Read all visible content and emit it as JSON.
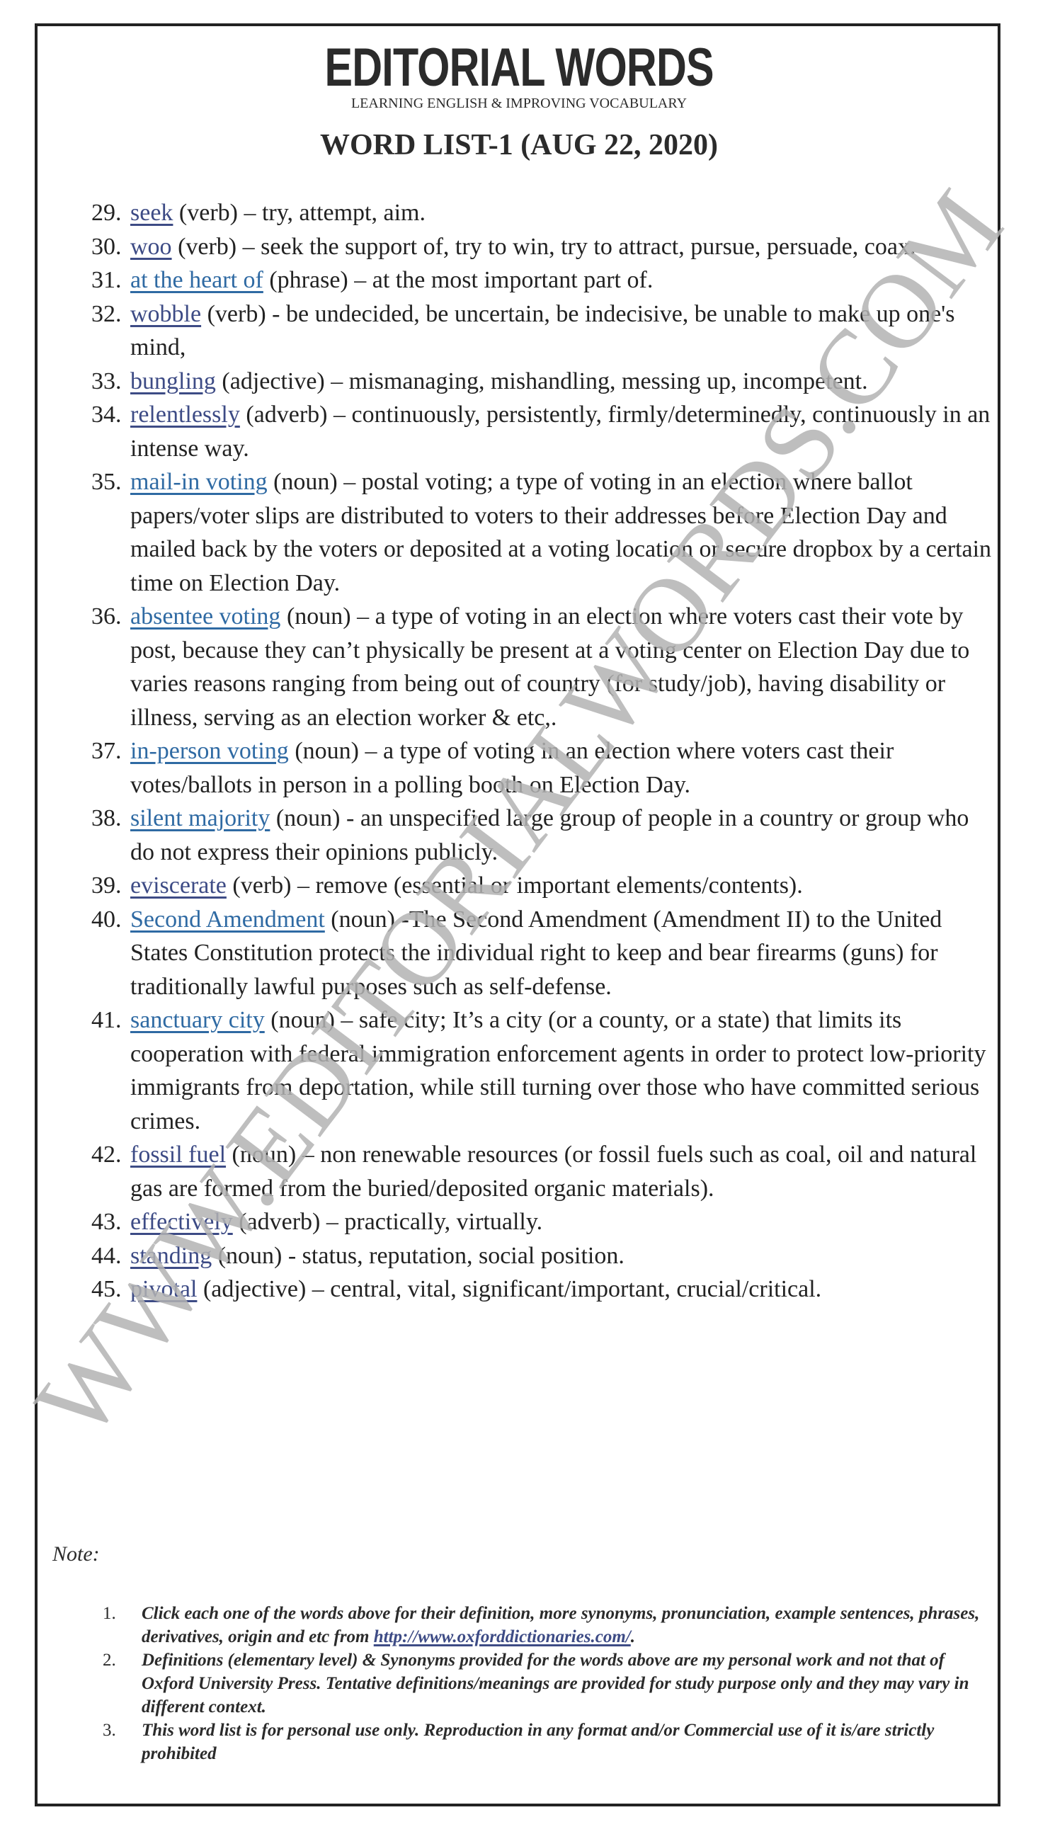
{
  "header": {
    "brand": "EDITORIAL WORDS",
    "tagline": "LEARNING ENGLISH & IMPROVING VOCABULARY",
    "list_title": "WORD LIST-1 (AUG 22, 2020)"
  },
  "watermark": "WWW.EDITORIALWORDS.COM",
  "colors": {
    "link_navy": "#3d4b85",
    "link_steel": "#2f6aa3",
    "text": "#222222",
    "watermark": "#b3b3b3"
  },
  "words": [
    {
      "num": "29.",
      "word": "seek",
      "color": "navy",
      "rest": " (verb) – try, attempt, aim."
    },
    {
      "num": "30.",
      "word": "woo",
      "color": "navy",
      "rest": " (verb) – seek the support of, try to win, try to attract, pursue, persuade, coax."
    },
    {
      "num": "31.",
      "word": "at the heart of",
      "color": "steel",
      "rest": " (phrase) – at the most important part of."
    },
    {
      "num": "32.",
      "word": "wobble",
      "color": "navy",
      "rest": " (verb) - be undecided, be uncertain, be indecisive, be unable to make up one's mind,"
    },
    {
      "num": "33.",
      "word": "bungling",
      "color": "navy",
      "rest": " (adjective) – mismanaging, mishandling, messing up, incompetent."
    },
    {
      "num": "34.",
      "word": "relentlessly",
      "color": "navy",
      "rest": " (adverb) – continuously, persistently, firmly/determinedly, continuously in an intense way."
    },
    {
      "num": "35.",
      "word": "mail-in voting",
      "color": "steel",
      "rest": " (noun) – postal voting; a type of voting in an election where ballot papers/voter slips are distributed to voters to their addresses before Election Day and mailed back by the voters or deposited at a voting location or secure dropbox by a certain time on Election Day."
    },
    {
      "num": "36.",
      "word": "absentee voting",
      "color": "steel",
      "rest": " (noun) – a type of voting in an election where voters cast their vote by post, because they can’t physically be present at a voting center on Election Day due to varies reasons ranging from being out of country (for study/job), having disability or illness, serving as an election worker & etc,."
    },
    {
      "num": "37.",
      "word": "in-person voting",
      "color": "steel",
      "rest": " (noun) – a type of voting in an election where voters cast their votes/ballots in person in a polling booth on Election Day."
    },
    {
      "num": "38.",
      "word": "silent majority",
      "color": "steel",
      "rest": " (noun) - an unspecified large group of people in a country or group who do not express their opinions publicly."
    },
    {
      "num": "39.",
      "word": "eviscerate",
      "color": "navy",
      "rest": " (verb) – remove (essential or important elements/contents)."
    },
    {
      "num": "40.",
      "word": "Second Amendment",
      "color": "steel",
      "rest": " (noun) -The Second Amendment (Amendment II) to the United States Constitution protects the individual right to keep and bear firearms (guns) for traditionally lawful purposes such as self-defense."
    },
    {
      "num": "41.",
      "word": "sanctuary city",
      "color": "steel",
      "rest": " (noun) – safe city; It’s a city (or a county, or a state) that limits its cooperation with federal immigration enforcement agents in order to protect low-priority immigrants from deportation, while still turning over those who have committed serious crimes."
    },
    {
      "num": "42.",
      "word": "fossil fuel",
      "color": "navy",
      "rest": " (noun) – non renewable resources (or fossil fuels such as coal, oil and natural gas are formed from the buried/deposited organic materials)."
    },
    {
      "num": "43.",
      "word": "effectively",
      "color": "navy",
      "rest": " (adverb) – practically, virtually."
    },
    {
      "num": "44.",
      "word": "standing",
      "color": "navy",
      "rest": " (noun) - status, reputation, social position."
    },
    {
      "num": "45.",
      "word": "pivotal",
      "color": "navy",
      "rest": " (adjective) – central, vital, significant/important, crucial/critical."
    }
  ],
  "note": {
    "label": "Note:",
    "items": [
      {
        "num": "1.",
        "text": "Click each one of the words above for their definition, more synonyms, pronunciation, example sentences, phrases, derivatives, origin and etc from ",
        "link": "http://www.oxforddictionaries.com/",
        "after": "."
      },
      {
        "num": "2.",
        "text": "Definitions (elementary level) & Synonyms provided for the words above are my personal work and not that of Oxford University Press. Tentative definitions/meanings are provided for study purpose only and they may vary in different context.",
        "link": null,
        "after": ""
      },
      {
        "num": "3.",
        "text": "This word list is for personal use only. Reproduction in any format and/or Commercial use of it is/are strictly prohibited",
        "link": null,
        "after": ""
      }
    ]
  }
}
